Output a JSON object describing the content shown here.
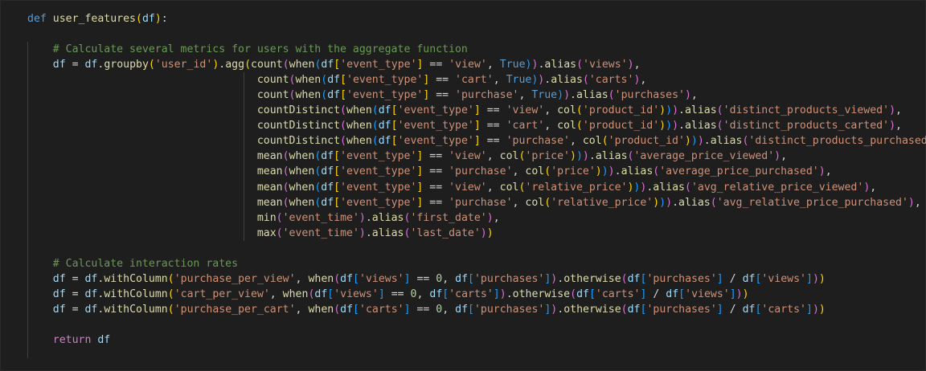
{
  "editor": {
    "language": "python",
    "theme_colors": {
      "background": "#1e1e1e",
      "keyword": "#569cd6",
      "function": "#dcdcaa",
      "variable": "#9cdcfe",
      "string": "#ce9178",
      "number": "#b5cea8",
      "comment": "#6a9955",
      "bracket_level_1": "#ffd700",
      "bracket_level_2": "#da70d6",
      "bracket_level_3": "#179fff"
    }
  },
  "code": {
    "def_keyword": "def",
    "func_name": "user_features",
    "param": "df",
    "comment_1": "# Calculate several metrics for users with the aggregate function",
    "comment_2": "# Calculate interaction rates",
    "return_keyword": "return",
    "col_user_id": "'user_id'",
    "col_event_type": "'event_type'",
    "val_view": "'view'",
    "val_cart": "'cart'",
    "val_purchase": "'purchase'",
    "col_product_id": "'product_id'",
    "col_price": "'price'",
    "col_relative_price": "'relative_price'",
    "col_event_time": "'event_time'",
    "alias_views": "'views'",
    "alias_carts": "'carts'",
    "alias_purchases": "'purchases'",
    "alias_dpv": "'distinct_products_viewed'",
    "alias_dpc": "'distinct_products_carted'",
    "alias_dpp": "'distinct_products_purchased'",
    "alias_apv": "'average_price_viewed'",
    "alias_app": "'average_price_purchased'",
    "alias_arpv": "'avg_relative_price_viewed'",
    "alias_arpp": "'avg_relative_price_purchased'",
    "alias_first": "'first_date'",
    "alias_last": "'last_date'",
    "col_ppv": "'purchase_per_view'",
    "col_cpv": "'cart_per_view'",
    "col_ppc": "'purchase_per_cart'",
    "zero": "0",
    "true_kw": "True"
  }
}
